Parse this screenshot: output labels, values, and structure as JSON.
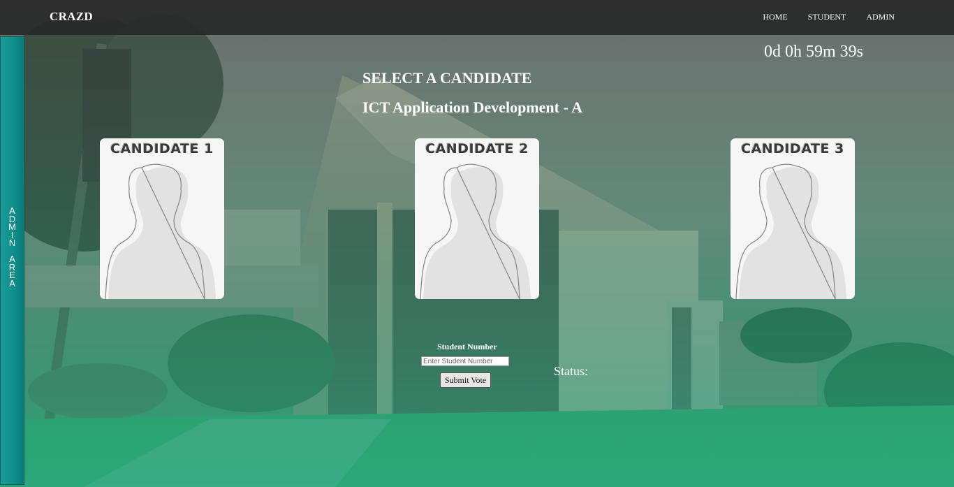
{
  "navbar": {
    "brand": "CRAZD",
    "links": [
      "HOME",
      "STUDENT",
      "ADMIN"
    ]
  },
  "side_tab": {
    "label": "A\nD\nM\nI\nN\n\nA\nR\nE\nA"
  },
  "countdown": "0d 0h 59m 39s",
  "heading": {
    "select": "SELECT A CANDIDATE",
    "course": "ICT Application Development - A"
  },
  "candidates": [
    {
      "label": "CANDIDATE 1"
    },
    {
      "label": "CANDIDATE 2"
    },
    {
      "label": "CANDIDATE 3"
    }
  ],
  "form": {
    "student_number_label": "Student Number",
    "student_number_placeholder": "Enter Student Number",
    "student_number_value": "",
    "submit_label": "Submit Vote",
    "status_label": "Status:"
  },
  "colors": {
    "navbar": "#282828",
    "side_tab": "#0f8f8c",
    "overlay": "#1f8c6a"
  }
}
